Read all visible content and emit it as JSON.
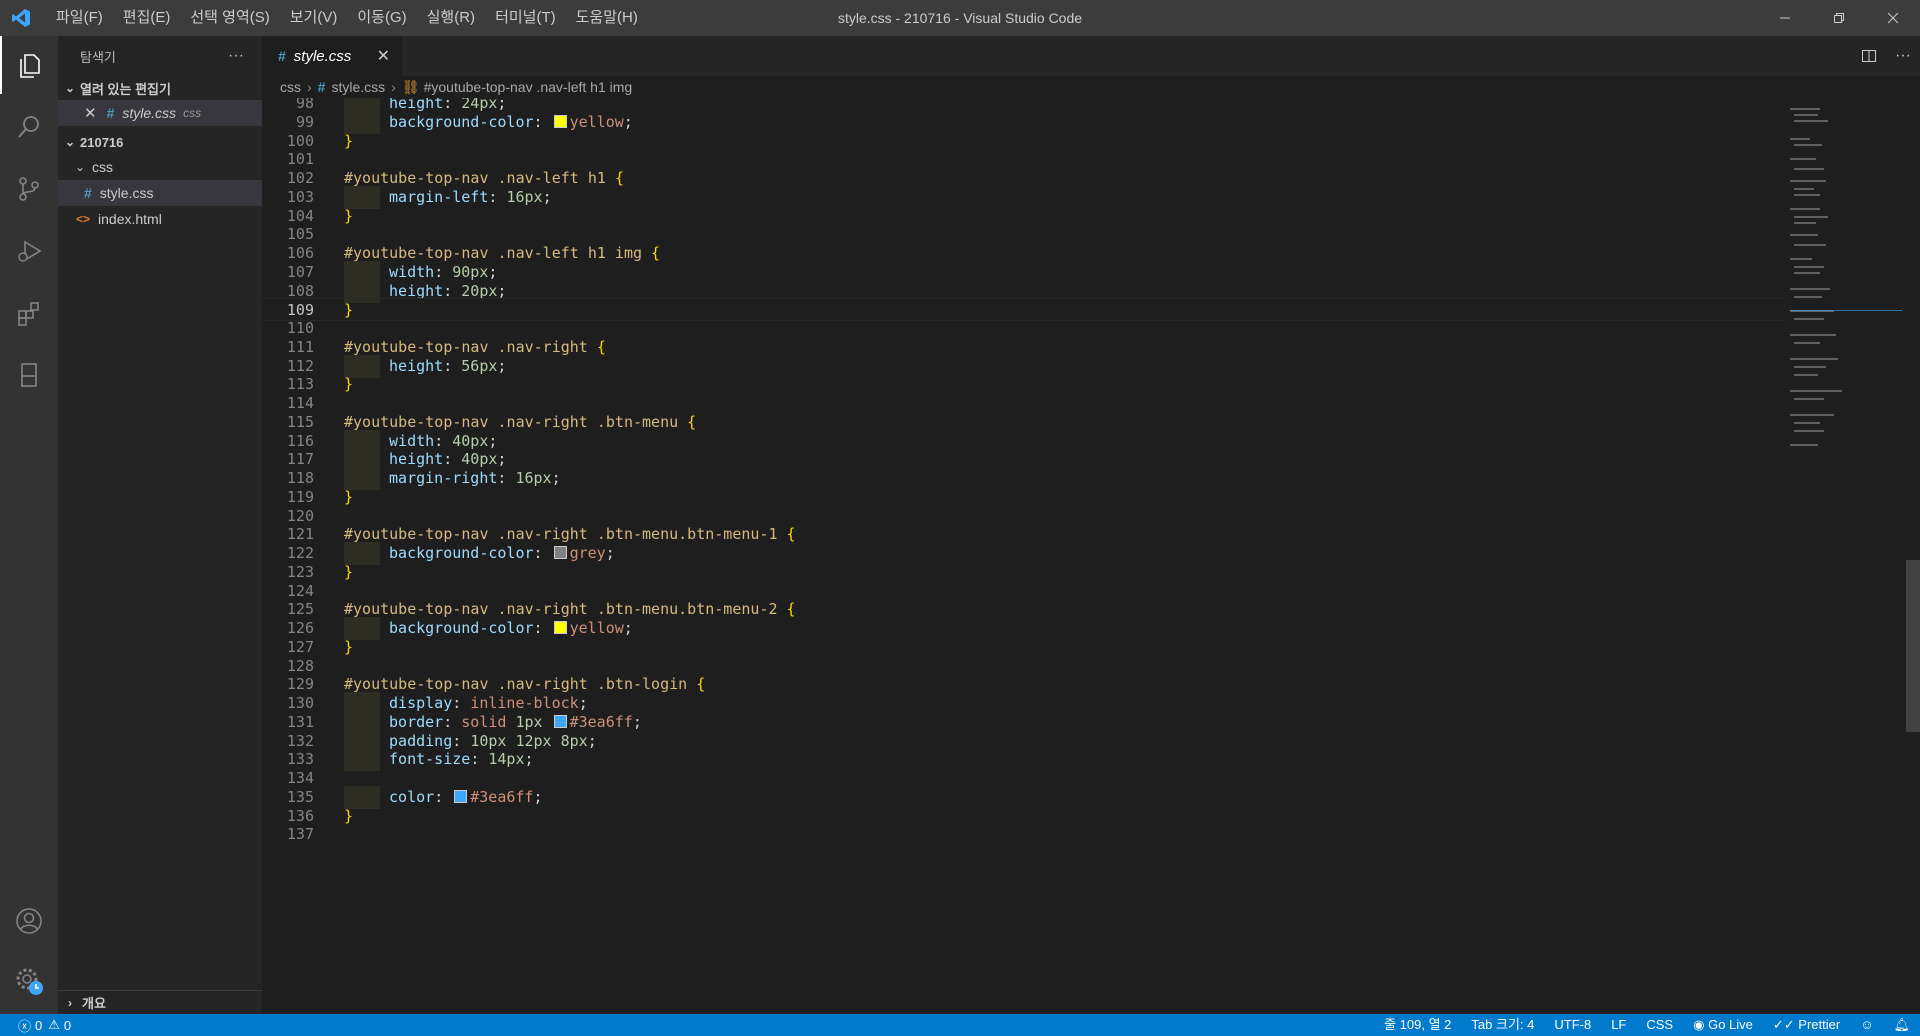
{
  "window": {
    "title": "style.css - 210716 - Visual Studio Code"
  },
  "menu": [
    "파일(F)",
    "편집(E)",
    "선택 영역(S)",
    "보기(V)",
    "이동(G)",
    "실행(R)",
    "터미널(T)",
    "도움말(H)"
  ],
  "sidebar": {
    "title": "탐색기",
    "more": "···",
    "open_editors_label": "열려 있는 편집기",
    "open_editor": {
      "name": "style.css",
      "folder": "css"
    },
    "workspace_label": "210716",
    "folder_css": "css",
    "file_style": "style.css",
    "file_index": "index.html",
    "outline_label": "개요"
  },
  "tab": {
    "label": "style.css",
    "icon": "#"
  },
  "breadcrumb": {
    "part1": "css",
    "part2": "style.css",
    "part3": "#youtube-top-nav .nav-left h1 img"
  },
  "code_lines": [
    {
      "n": "98",
      "t": "    height: 24px;"
    },
    {
      "n": "99",
      "t": "    background-color: yellow;"
    },
    {
      "n": "100",
      "t": "}"
    },
    {
      "n": "101",
      "t": ""
    },
    {
      "n": "102",
      "t": "#youtube-top-nav .nav-left h1 {"
    },
    {
      "n": "103",
      "t": "    margin-left: 16px;"
    },
    {
      "n": "104",
      "t": "}"
    },
    {
      "n": "105",
      "t": ""
    },
    {
      "n": "106",
      "t": "#youtube-top-nav .nav-left h1 img {"
    },
    {
      "n": "107",
      "t": "    width: 90px;"
    },
    {
      "n": "108",
      "t": "    height: 20px;"
    },
    {
      "n": "109",
      "t": "}"
    },
    {
      "n": "110",
      "t": ""
    },
    {
      "n": "111",
      "t": "#youtube-top-nav .nav-right {"
    },
    {
      "n": "112",
      "t": "    height: 56px;"
    },
    {
      "n": "113",
      "t": "}"
    },
    {
      "n": "114",
      "t": ""
    },
    {
      "n": "115",
      "t": "#youtube-top-nav .nav-right .btn-menu {"
    },
    {
      "n": "116",
      "t": "    width: 40px;"
    },
    {
      "n": "117",
      "t": "    height: 40px;"
    },
    {
      "n": "118",
      "t": "    margin-right: 16px;"
    },
    {
      "n": "119",
      "t": "}"
    },
    {
      "n": "120",
      "t": ""
    },
    {
      "n": "121",
      "t": "#youtube-top-nav .nav-right .btn-menu.btn-menu-1 {"
    },
    {
      "n": "122",
      "t": "    background-color: grey;"
    },
    {
      "n": "123",
      "t": "}"
    },
    {
      "n": "124",
      "t": ""
    },
    {
      "n": "125",
      "t": "#youtube-top-nav .nav-right .btn-menu.btn-menu-2 {"
    },
    {
      "n": "126",
      "t": "    background-color: yellow;"
    },
    {
      "n": "127",
      "t": "}"
    },
    {
      "n": "128",
      "t": ""
    },
    {
      "n": "129",
      "t": "#youtube-top-nav .nav-right .btn-login {"
    },
    {
      "n": "130",
      "t": "    display: inline-block;"
    },
    {
      "n": "131",
      "t": "    border: solid 1px #3ea6ff;"
    },
    {
      "n": "132",
      "t": "    padding: 10px 12px 8px;"
    },
    {
      "n": "133",
      "t": "    font-size: 14px;"
    },
    {
      "n": "134",
      "t": ""
    },
    {
      "n": "135",
      "t": "    color: #3ea6ff;"
    },
    {
      "n": "136",
      "t": "}"
    },
    {
      "n": "137",
      "t": ""
    }
  ],
  "current_line": "109",
  "colors": {
    "yellow": "#ffff00",
    "grey": "#808080",
    "blue": "#3ea6ff",
    "statusbar": "#007acc"
  },
  "status": {
    "errors": "0",
    "warnings": "0",
    "position": "줄 109, 열 2",
    "tab_size": "Tab 크기: 4",
    "encoding": "UTF-8",
    "eol": "LF",
    "language": "CSS",
    "golive": "Go Live",
    "prettier": "Prettier"
  }
}
